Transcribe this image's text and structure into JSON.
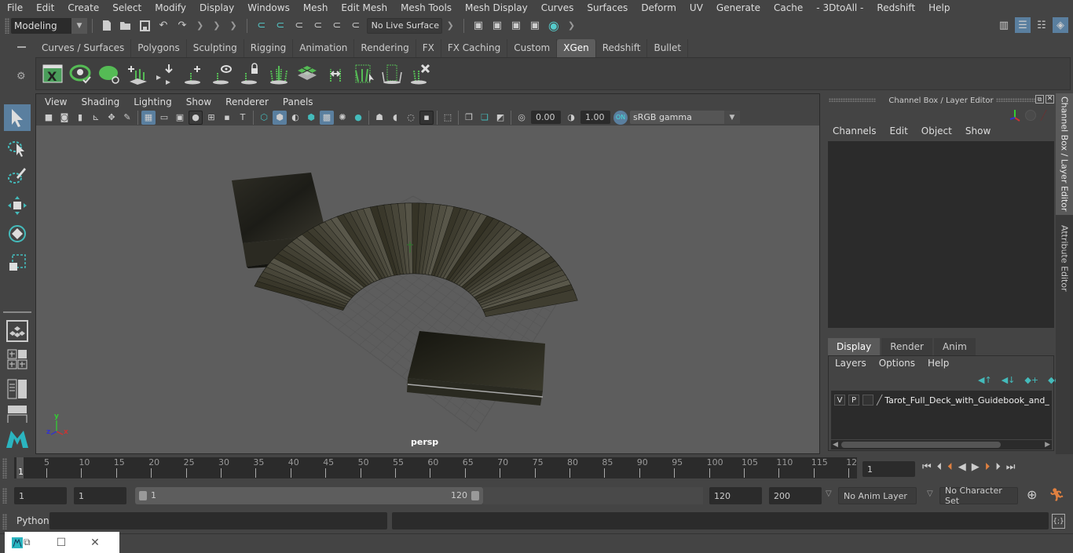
{
  "menubar": [
    "File",
    "Edit",
    "Create",
    "Select",
    "Modify",
    "Display",
    "Windows",
    "Mesh",
    "Edit Mesh",
    "Mesh Tools",
    "Mesh Display",
    "Curves",
    "Surfaces",
    "Deform",
    "UV",
    "Generate",
    "Cache",
    "- 3DtoAll -",
    "Redshift",
    "Help"
  ],
  "statusline": {
    "mode": "Modeling",
    "live_surface": "No Live Surface"
  },
  "shelf": {
    "tabs": [
      "Curves / Surfaces",
      "Polygons",
      "Sculpting",
      "Rigging",
      "Animation",
      "Rendering",
      "FX",
      "FX Caching",
      "Custom",
      "XGen",
      "Redshift",
      "Bullet"
    ],
    "active_tab": "XGen",
    "icons": [
      "xgen-editor-icon",
      "xgen-preview-icon",
      "xgen-clear-preview-icon",
      "add-guides-icon",
      "place-guides-icon",
      "add-guide-icon",
      "guide-visibility-icon",
      "lock-guide-icon",
      "guide-split-icon",
      "grooming-tools-icon",
      "flip-guides-icon",
      "region-map-icon",
      "select-guides-icon",
      "delete-guides-icon"
    ]
  },
  "viewport": {
    "menu": [
      "View",
      "Shading",
      "Lighting",
      "Show",
      "Renderer",
      "Panels"
    ],
    "exposure": "0.00",
    "gamma": "1.00",
    "color_mgmt": "ON",
    "color_space": "sRGB gamma",
    "camera": "persp",
    "axes": {
      "x": "x",
      "y": "y",
      "z": "z"
    }
  },
  "channel_box": {
    "title": "Channel Box / Layer Editor",
    "menu": [
      "Channels",
      "Edit",
      "Object",
      "Show"
    ]
  },
  "layer_editor": {
    "tabs": [
      "Display",
      "Render",
      "Anim"
    ],
    "active_tab": "Display",
    "menu": [
      "Layers",
      "Options",
      "Help"
    ],
    "layers": [
      {
        "v": "V",
        "p": "P",
        "name": "Tarot_Full_Deck_with_Guidebook_and_E"
      }
    ]
  },
  "side_tabs": [
    "Channel Box / Layer Editor",
    "Attribute Editor"
  ],
  "timeline": {
    "ticks": [
      "5",
      "10",
      "15",
      "20",
      "25",
      "30",
      "35",
      "40",
      "45",
      "50",
      "55",
      "60",
      "65",
      "70",
      "75",
      "80",
      "85",
      "90",
      "95",
      "100",
      "105",
      "110",
      "115",
      "12"
    ],
    "current_frame_marker": "1",
    "current_frame": "1"
  },
  "range": {
    "start": "1",
    "playback_start": "1",
    "slider_start": "1",
    "slider_end": "120",
    "playback_end": "120",
    "end": "200",
    "anim_layer": "No Anim Layer",
    "character_set": "No Character Set"
  },
  "command_line": {
    "label": "Python",
    "value": ""
  }
}
